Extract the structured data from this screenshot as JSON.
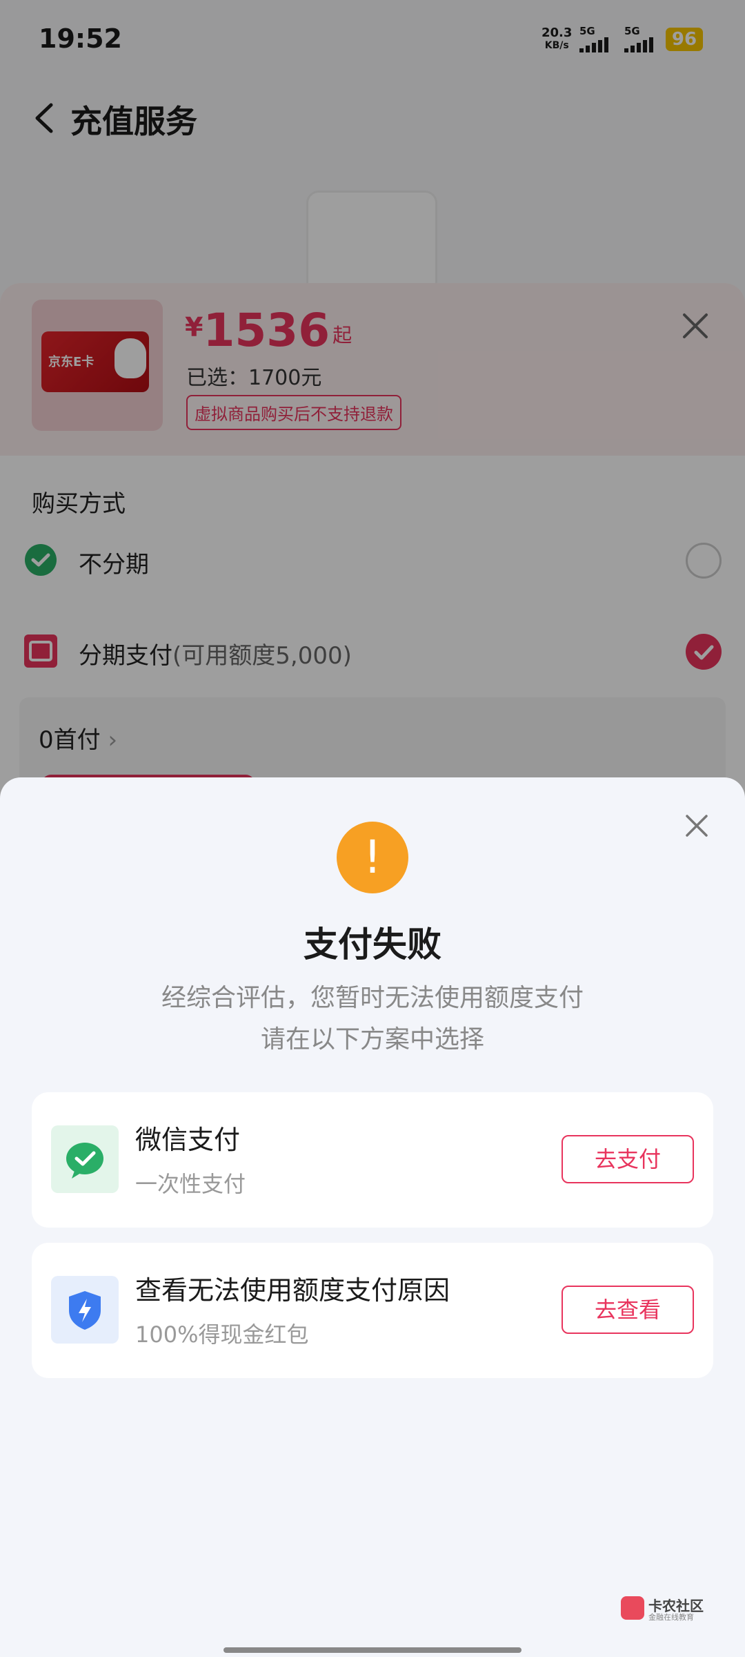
{
  "status_bar": {
    "time": "19:52",
    "speed_value": "20.3",
    "speed_unit": "KB/s",
    "sim1": "5G",
    "sim2": "5G",
    "battery": "96"
  },
  "app_bar": {
    "title": "充值服务"
  },
  "product": {
    "card_text": "京东E卡",
    "currency": "¥",
    "price": "1536",
    "price_suffix": "起",
    "selected": "已选：1700元",
    "notice": "虚拟商品购买后不支持退款"
  },
  "purchase": {
    "title": "购买方式",
    "options": [
      {
        "label": "不分期",
        "sub": "",
        "selected": false
      },
      {
        "label": "分期支付",
        "sub": "(可用额度5,000)",
        "selected": true
      }
    ],
    "plan_label": "0首付"
  },
  "modal": {
    "title": "支付失败",
    "desc_line1": "经综合评估，您暂时无法使用额度支付",
    "desc_line2": "请在以下方案中选择",
    "cards": [
      {
        "title": "微信支付",
        "subtitle": "一次性支付",
        "button": "去支付",
        "icon": "wechat-pay-icon"
      },
      {
        "title": "查看无法使用额度支付原因",
        "subtitle": "100%得现金红包",
        "button": "去查看",
        "icon": "shield-lightning-icon"
      }
    ]
  },
  "watermark": {
    "name": "卡农社区",
    "tagline": "金融在线教育"
  },
  "colors": {
    "accent": "#e8345d",
    "warning": "#f7a023",
    "wechat": "#2aae67",
    "shield": "#3d7bf0"
  }
}
